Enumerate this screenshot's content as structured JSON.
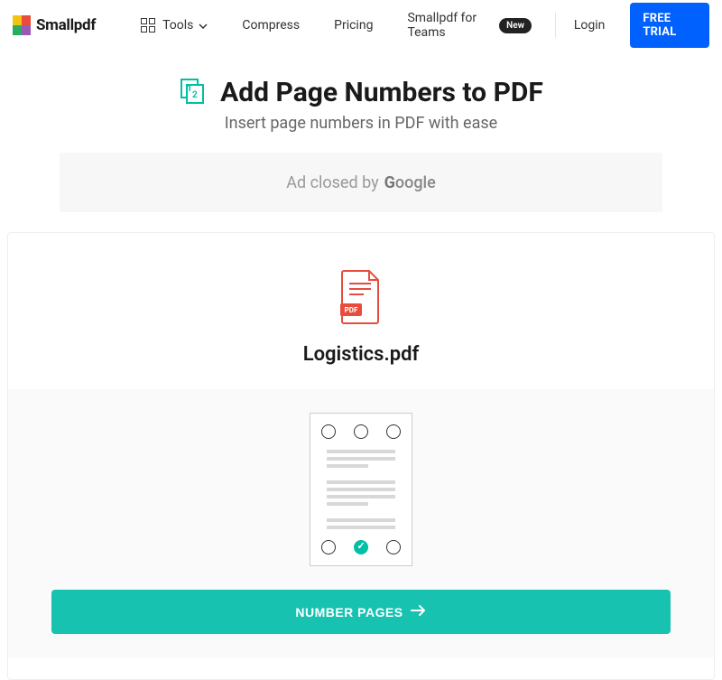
{
  "header": {
    "brand": "Smallpdf",
    "nav": {
      "tools": "Tools",
      "compress": "Compress",
      "pricing": "Pricing",
      "teams": "Smallpdf for Teams",
      "teams_badge": "New",
      "login": "Login",
      "trial": "FREE TRIAL"
    }
  },
  "page": {
    "title": "Add Page Numbers to PDF",
    "subtitle": "Insert page numbers in PDF with ease"
  },
  "ad": {
    "text": "Ad closed by",
    "provider": "Google"
  },
  "file": {
    "name": "Logistics.pdf",
    "badge": "PDF"
  },
  "picker": {
    "selected_position": "bottom-center"
  },
  "action": {
    "label": "NUMBER PAGES"
  },
  "colors": {
    "primary_blue": "#0061ff",
    "accent_teal": "#18c2b0",
    "pdf_red": "#e74c3c"
  }
}
